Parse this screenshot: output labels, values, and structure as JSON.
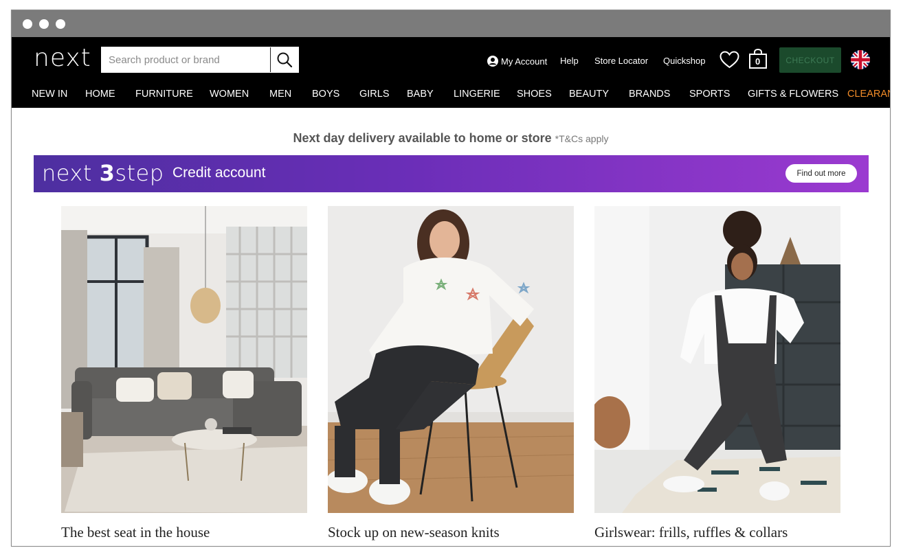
{
  "header": {
    "logo": "next",
    "search_placeholder": "Search product or brand",
    "links": {
      "my_account": "My Account",
      "help": "Help",
      "store_locator": "Store Locator",
      "quickshop": "Quickshop"
    },
    "bag_count": "0",
    "checkout": "CHECKOUT"
  },
  "nav": [
    "NEW IN",
    "HOME",
    "FURNITURE",
    "WOMEN",
    "MEN",
    "BOYS",
    "GIRLS",
    "BABY",
    "LINGERIE",
    "SHOES",
    "BEAUTY",
    "BRANDS",
    "SPORTS",
    "GIFTS & FLOWERS",
    "CLEARANCE"
  ],
  "delivery": {
    "main": "Next day delivery available to home or store",
    "note": "*T&Cs apply"
  },
  "banner": {
    "logo_word": "next",
    "logo_three": "3",
    "logo_step": "step",
    "text": "Credit account",
    "button": "Find out more"
  },
  "cards": [
    {
      "title": "The best seat in the house"
    },
    {
      "title": "Stock up on new-season knits"
    },
    {
      "title": "Girlswear: frills, ruffles & collars"
    }
  ],
  "colors": {
    "clearance": "#f28c28",
    "checkout_bg": "#1b4a2c",
    "banner_start": "#4d2fa0",
    "banner_end": "#9b3ad0"
  }
}
